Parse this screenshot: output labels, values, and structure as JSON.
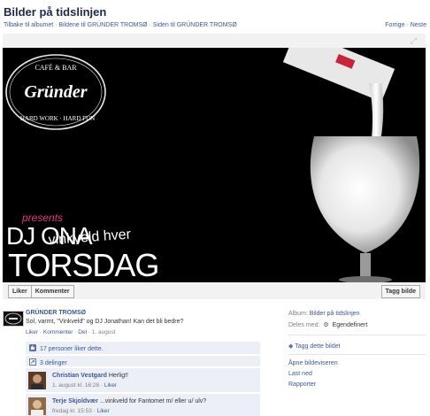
{
  "page": {
    "title": "Bilder på tidslinjen"
  },
  "breadcrumbs": {
    "back_album": "Tilbake til albumet",
    "sep1": " · ",
    "owner_photos": "Bildene til GRÜNDER TROMSØ",
    "sep2": " · ",
    "owner_page": "Siden til GRÜNDER TROMSØ"
  },
  "pager": {
    "prev": "Forrige",
    "sep": " · ",
    "next": "Neste"
  },
  "photo": {
    "logo_top": "CAFÉ & BAR",
    "logo_name": "Gründer",
    "logo_bottom": "HARD WORK · HARD FUN",
    "presents": "presents",
    "dj_name": "DJ ONA",
    "line2": "vinkveld hver",
    "line3": "TORSDAG"
  },
  "actions": {
    "like": "Liker",
    "comment": "Kommenter",
    "tag": "Tagg bilde"
  },
  "post": {
    "owner": "GRÜNDER TROMSØ",
    "text": "Sol, varmt, \"Vinkveld\" og DJ Jonathan! Kan det bli bedre?",
    "like": "Liker",
    "comment": "Kommenter",
    "share": "Del",
    "date": "1. august",
    "dot": " · "
  },
  "ufi": {
    "likes": "17 personer liker dette.",
    "shares": "3 delinger"
  },
  "comments": [
    {
      "name": "Christian Vestgard",
      "text": "Herlig!!",
      "time": "1. august kl. 16:28",
      "like": "Liker"
    },
    {
      "name": "Terje Skjoldvær",
      "text": "...vinkveld for Fantomet m/ eller u/ ulv?",
      "time": "fredag kl. 15:53",
      "like": "Liker"
    }
  ],
  "sidebar": {
    "album_label": "Album:",
    "album_value": "Bilder på tidslinjen",
    "shared_label": "Deles med:",
    "shared_value": "Egendefinert",
    "tag_photo": "Tagg dette bildet",
    "open_viewer": "Åpne bildeviseren",
    "download": "Last ned",
    "report": "Rapporter"
  },
  "colors": {
    "link": "#3b5998",
    "ufi_bg": "#eceff5",
    "accent_pink": "#e0358a"
  }
}
